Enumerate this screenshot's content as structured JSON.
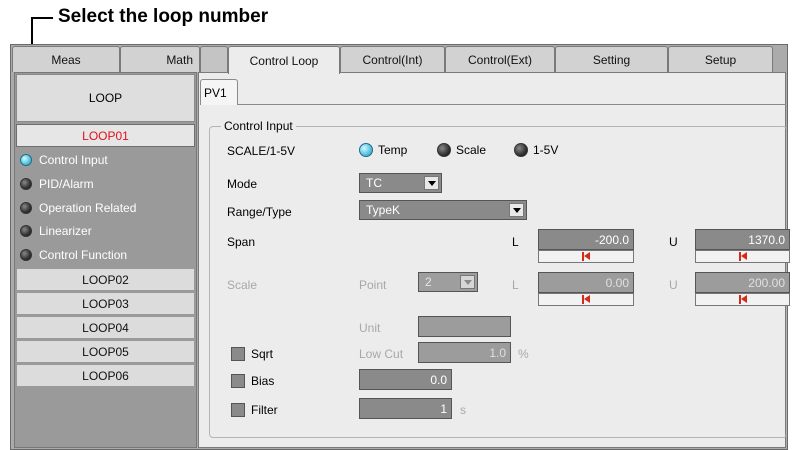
{
  "callout": {
    "text": "Select the loop number"
  },
  "top_tabs": [
    {
      "label": "Meas"
    },
    {
      "label": "Math"
    },
    {
      "label": "Control Loop"
    },
    {
      "label": "Control(Int)"
    },
    {
      "label": "Control(Ext)"
    },
    {
      "label": "Setting"
    },
    {
      "label": "Setup"
    }
  ],
  "sidebar": {
    "header": "LOOP",
    "selected_loop": "LOOP01",
    "sub_items": [
      {
        "label": "Control Input",
        "active": true
      },
      {
        "label": "PID/Alarm"
      },
      {
        "label": "Operation Related"
      },
      {
        "label": "Linearizer"
      },
      {
        "label": "Control Function"
      }
    ],
    "loops": [
      "LOOP02",
      "LOOP03",
      "LOOP04",
      "LOOP05",
      "LOOP06"
    ]
  },
  "content": {
    "tab": "PV1",
    "group_title": "Control Input",
    "scale_label": "SCALE/1-5V",
    "radio_options": [
      "Temp",
      "Scale",
      "1-5V"
    ],
    "radio_selected": "Temp",
    "mode": {
      "label": "Mode",
      "value": "TC"
    },
    "range": {
      "label": "Range/Type",
      "value": "TypeK"
    },
    "span": {
      "label": "Span",
      "l_label": "L",
      "l_value": "-200.0",
      "u_label": "U",
      "u_value": "1370.0"
    },
    "scale": {
      "label": "Scale",
      "point_label": "Point",
      "point_value": "2",
      "l_label": "L",
      "l_value": "0.00",
      "u_label": "U",
      "u_value": "200.00"
    },
    "unit": {
      "label": "Unit",
      "value": ""
    },
    "sqrt": {
      "label": "Sqrt",
      "low_cut_label": "Low Cut",
      "low_cut_value": "1.0",
      "low_cut_unit": "%"
    },
    "bias": {
      "label": "Bias",
      "value": "0.0"
    },
    "filter": {
      "label": "Filter",
      "value": "1",
      "unit": "s"
    }
  }
}
